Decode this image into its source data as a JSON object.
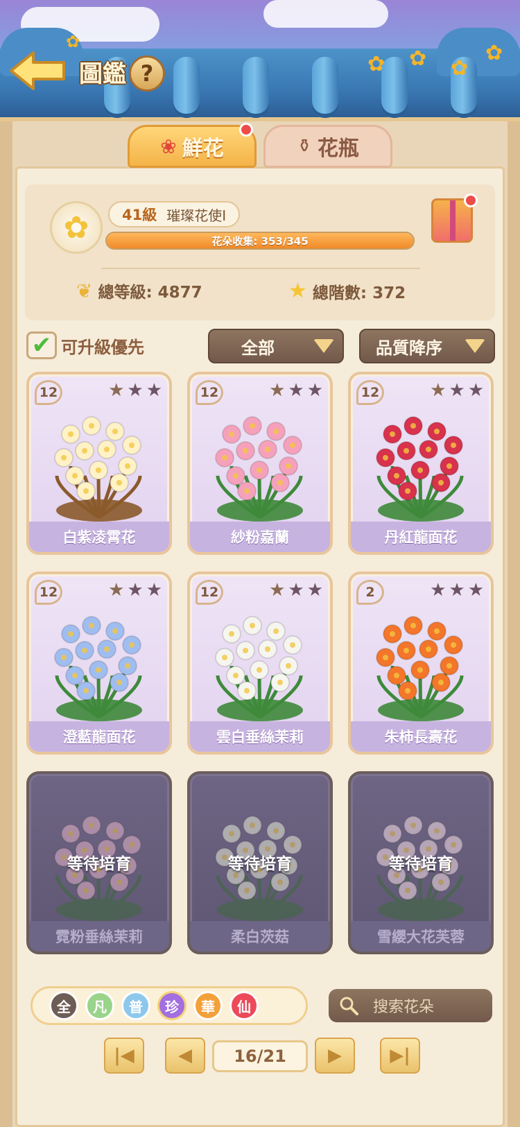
{
  "header": {
    "title": "圖鑑",
    "help_label": "?"
  },
  "tabs": [
    {
      "label": "鮮花",
      "active": true,
      "has_notification": true
    },
    {
      "label": "花瓶",
      "active": false,
      "has_notification": false
    }
  ],
  "profile": {
    "level": "41級",
    "rank_title": "璀璨花使I",
    "collection_progress_text": "花朵收集: 353/345",
    "collection_progress_fraction": 1.0,
    "total_level_label": "總等級: 4877",
    "total_stars_label": "總階數: 372",
    "gift_has_notification": true
  },
  "filters": {
    "upgradable_first_label": "可升級優先",
    "upgradable_first_checked": true,
    "category_value": "全部",
    "sort_value": "品質降序"
  },
  "cards": [
    {
      "name": "白紫凌霄花",
      "level": "12",
      "stars_filled": 1,
      "locked": false,
      "color": "#fff2c6",
      "accent": "#8b5a2b"
    },
    {
      "name": "紗粉嘉蘭",
      "level": "12",
      "stars_filled": 1,
      "locked": false,
      "color": "#f6a1bb",
      "accent": "#3e8a3a"
    },
    {
      "name": "丹紅龍面花",
      "level": "12",
      "stars_filled": 1,
      "locked": false,
      "color": "#d8324c",
      "accent": "#3e8a3a"
    },
    {
      "name": "澄藍龍面花",
      "level": "12",
      "stars_filled": 1,
      "locked": false,
      "color": "#9fbdf0",
      "accent": "#3e8a3a"
    },
    {
      "name": "雲白垂絲茉莉",
      "level": "12",
      "stars_filled": 1,
      "locked": false,
      "color": "#f6f6f0",
      "accent": "#3e8a3a"
    },
    {
      "name": "朱柿長壽花",
      "level": "2",
      "stars_filled": 0,
      "locked": false,
      "color": "#f3762a",
      "accent": "#3e8a3a"
    },
    {
      "name": "霓粉垂絲茉莉",
      "level": "",
      "stars_filled": 0,
      "locked": true,
      "status": "等待培育",
      "color": "#e4b3c9",
      "accent": "#3b6a39"
    },
    {
      "name": "柔白茨菇",
      "level": "",
      "stars_filled": 0,
      "locked": true,
      "status": "等待培育",
      "color": "#e8ecd8",
      "accent": "#3b6a39"
    },
    {
      "name": "雪纓大花芙蓉",
      "level": "",
      "stars_filled": 0,
      "locked": true,
      "status": "等待培育",
      "color": "#f6dfe6",
      "accent": "#3b6a39"
    }
  ],
  "rarity_filters": [
    {
      "label": "全",
      "color": "#6d5d55",
      "selected": false
    },
    {
      "label": "凡",
      "color": "#9ad48b",
      "selected": false
    },
    {
      "label": "普",
      "color": "#8ec7ec",
      "selected": false
    },
    {
      "label": "珍",
      "color": "#a26ee0",
      "selected": true
    },
    {
      "label": "華",
      "color": "#f4a03a",
      "selected": false
    },
    {
      "label": "仙",
      "color": "#ec4a5a",
      "selected": false
    }
  ],
  "search": {
    "placeholder": "搜索花朵",
    "icon": "magnifier-icon"
  },
  "pager": {
    "page_label": "16/21"
  }
}
